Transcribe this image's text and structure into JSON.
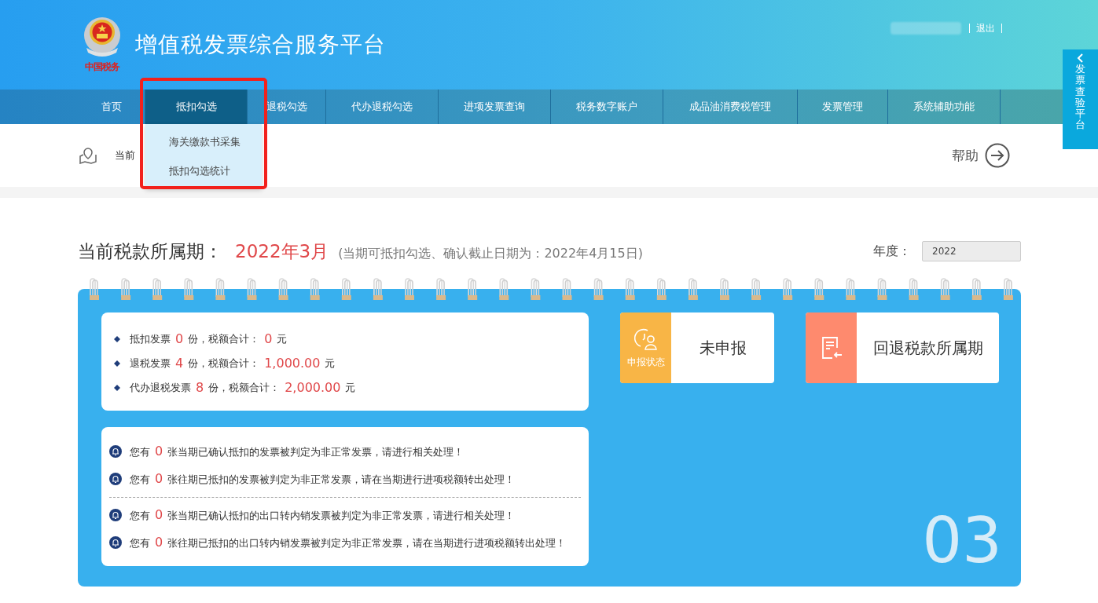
{
  "header": {
    "title": "增值税发票综合服务平台",
    "logo_caption": "中国税务",
    "logout": "退出"
  },
  "side_tab": {
    "label": "发票查验平台"
  },
  "nav": [
    {
      "label": "首页",
      "selected": false
    },
    {
      "label": "抵扣勾选",
      "selected": true
    },
    {
      "label": "退税勾选",
      "selected": false
    },
    {
      "label": "代办退税勾选",
      "selected": false
    },
    {
      "label": "进项发票查询",
      "selected": false
    },
    {
      "label": "税务数字账户",
      "selected": false
    },
    {
      "label": "成品油消费税管理",
      "selected": false
    },
    {
      "label": "发票管理",
      "selected": false
    },
    {
      "label": "系统辅助功能",
      "selected": false
    }
  ],
  "dropdown": [
    "海关缴款书采集",
    "抵扣勾选统计"
  ],
  "breadcrumb": {
    "label": "当前"
  },
  "help": "帮助",
  "period": {
    "label": "当前税款所属期：",
    "value": "2022年3月",
    "note": "(当期可抵扣勾选、确认截止日期为：2022年4月15日)"
  },
  "year": {
    "label": "年度：",
    "value": "2022"
  },
  "summary": [
    {
      "name": "抵扣发票",
      "count": "0",
      "mid": "份，税额合计：",
      "amount": "0",
      "unit": "元"
    },
    {
      "name": "退税发票",
      "count": "4",
      "mid": "份，税额合计：",
      "amount": "1,000.00",
      "unit": "元"
    },
    {
      "name": "代办退税发票",
      "count": "8",
      "mid": "份，税额合计：",
      "amount": "2,000.00",
      "unit": "元"
    }
  ],
  "alerts": [
    [
      {
        "prefix": "您有",
        "count": "0",
        "text": "张当期已确认抵扣的发票被判定为非正常发票，请进行相关处理！"
      },
      {
        "prefix": "您有",
        "count": "0",
        "text": "张往期已抵扣的发票被判定为非正常发票，请在当期进行进项税额转出处理！"
      }
    ],
    [
      {
        "prefix": "您有",
        "count": "0",
        "text": "张当期已确认抵扣的出口转内销发票被判定为非正常发票，请进行相关处理！"
      },
      {
        "prefix": "您有",
        "count": "0",
        "text": "张往期已抵扣的出口转内销发票被判定为非正常发票，请在当期进行进项税额转出处理！"
      }
    ]
  ],
  "status_card": {
    "caption": "申报状态",
    "value": "未申报"
  },
  "rollback_card": {
    "label": "回退税款所属期"
  },
  "month": "03"
}
